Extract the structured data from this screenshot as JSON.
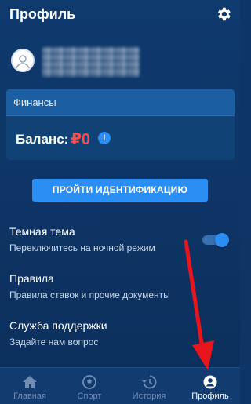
{
  "header": {
    "title": "Профиль",
    "settings_icon": "gear-icon"
  },
  "profile": {
    "avatar_icon": "user-avatar-icon"
  },
  "finance": {
    "header": "Финансы",
    "balance_label": "Баланс:",
    "balance_value": "₽0",
    "info_icon": "info-icon",
    "info_glyph": "!"
  },
  "identify_button": "ПРОЙТИ ИДЕНТИФИКАЦИЮ",
  "settings": [
    {
      "title": "Темная тема",
      "subtitle": "Переключитесь на ночной режим",
      "toggle_on": true
    },
    {
      "title": "Правила",
      "subtitle": "Правила ставок и прочие документы"
    },
    {
      "title": "Служба поддержки",
      "subtitle": "Задайте нам вопрос"
    }
  ],
  "bottom_nav": [
    {
      "label": "Главная",
      "icon": "home-icon",
      "active": false
    },
    {
      "label": "Спорт",
      "icon": "soccer-ball-icon",
      "active": false
    },
    {
      "label": "История",
      "icon": "history-icon",
      "active": false
    },
    {
      "label": "Профиль",
      "icon": "profile-icon",
      "active": true
    }
  ],
  "colors": {
    "background": "#0f3a6e",
    "accent": "#2b8ef5",
    "balance": "#ff4b4b",
    "annotation": "#e8161c"
  }
}
